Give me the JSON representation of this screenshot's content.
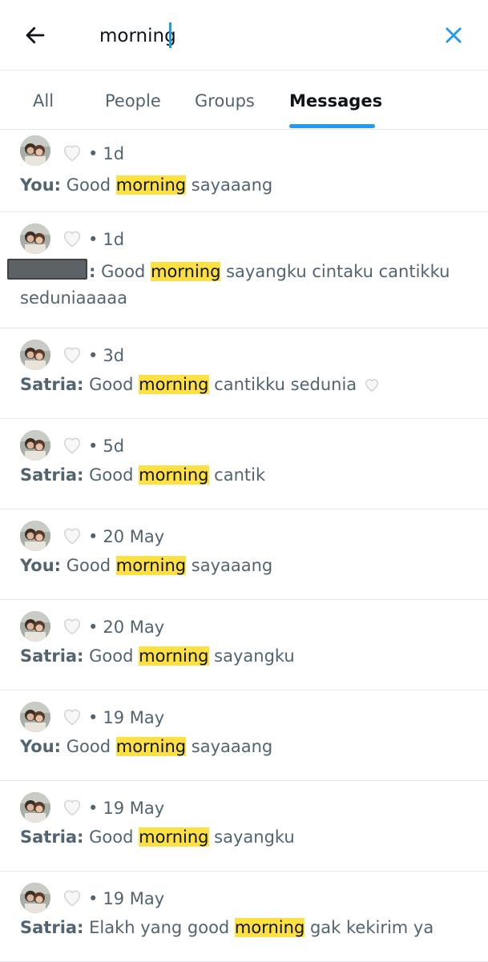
{
  "search": {
    "query": "morning",
    "icons": {
      "back": "arrow-left-icon",
      "clear": "close-icon"
    },
    "accent_color": "#1d9bf0"
  },
  "tabs": [
    {
      "label": "All",
      "active": false
    },
    {
      "label": "People",
      "active": false
    },
    {
      "label": "Groups",
      "active": false
    },
    {
      "label": "Messages",
      "active": true
    }
  ],
  "highlight_color": "#ffe042",
  "results": [
    {
      "reaction": "white-heart",
      "time": "1d",
      "sender": "You:",
      "pre": "Good ",
      "match": "morning",
      "post": " sayaaang"
    },
    {
      "reaction": "white-heart",
      "time": "1d",
      "sender": ":",
      "sender_redacted": true,
      "pre": " Good ",
      "match": "morning",
      "post": " sayangku cintaku cantikku seduniaaaaa"
    },
    {
      "reaction": "white-heart",
      "time": "3d",
      "sender": "Satria:",
      "pre": "Good ",
      "match": "morning",
      "post": " cantikku sedunia",
      "trailing_emoji": "white-heart"
    },
    {
      "reaction": "white-heart",
      "time": "5d",
      "sender": "Satria:",
      "pre": "Good ",
      "match": "morning",
      "post": " cantik"
    },
    {
      "reaction": "white-heart",
      "time": "20 May",
      "sender": "You:",
      "pre": "Good ",
      "match": "morning",
      "post": " sayaaang"
    },
    {
      "reaction": "white-heart",
      "time": "20 May",
      "sender": "Satria:",
      "pre": "Good ",
      "match": "morning",
      "post": " sayangku"
    },
    {
      "reaction": "white-heart",
      "time": "19 May",
      "sender": "You:",
      "pre": "Good ",
      "match": "morning",
      "post": " sayaaang"
    },
    {
      "reaction": "white-heart",
      "time": "19 May",
      "sender": "Satria:",
      "pre": "Good ",
      "match": "morning",
      "post": " sayangku"
    },
    {
      "reaction": "white-heart",
      "time": "19 May",
      "sender": "Satria:",
      "pre": "Elakh yang good ",
      "match": "morning",
      "post": " gak kekirim ya"
    }
  ],
  "separator": "•"
}
